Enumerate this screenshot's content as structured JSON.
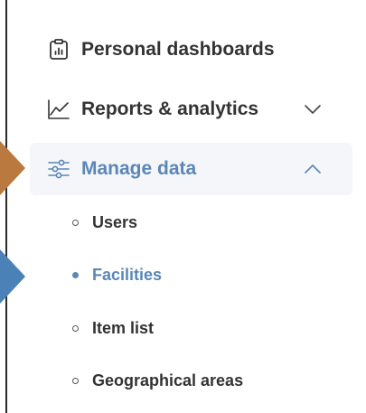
{
  "nav": {
    "items": [
      {
        "label": "Personal dashboards",
        "icon": "clipboard-chart-icon"
      },
      {
        "label": "Reports & analytics",
        "icon": "line-chart-icon",
        "chevron": "chevron-down-icon"
      },
      {
        "label": "Manage data",
        "icon": "sliders-icon",
        "chevron": "chevron-up-icon",
        "active": true
      }
    ],
    "sub_items": [
      {
        "label": "Users"
      },
      {
        "label": "Facilities",
        "selected": true
      },
      {
        "label": "Item list"
      },
      {
        "label": "Geographical areas"
      }
    ]
  },
  "colors": {
    "accent": "#5b86b7",
    "text": "#333333",
    "active_bg": "#f4f6f9",
    "pointer_orange": "#b9793f",
    "pointer_blue": "#4a82b8"
  }
}
